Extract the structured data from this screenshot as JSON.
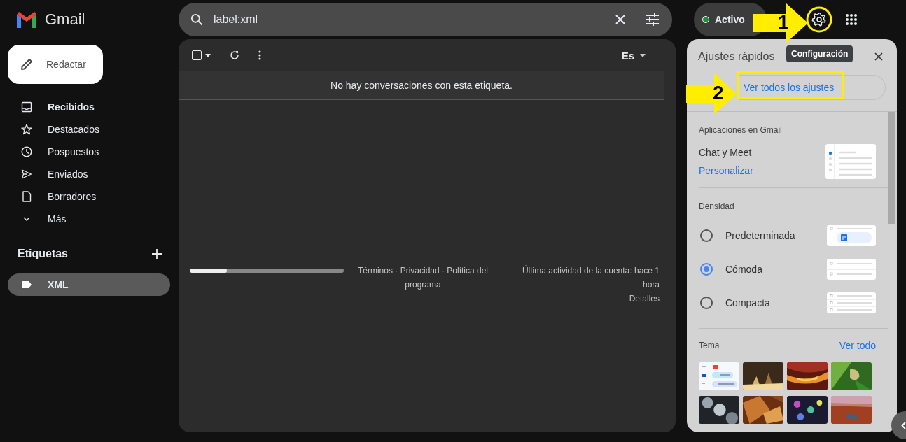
{
  "app": {
    "name": "Gmail"
  },
  "compose": {
    "label": "Redactar"
  },
  "nav": [
    {
      "label": "Recibidos",
      "selected": true
    },
    {
      "label": "Destacados",
      "selected": false
    },
    {
      "label": "Pospuestos",
      "selected": false
    },
    {
      "label": "Enviados",
      "selected": false
    },
    {
      "label": "Borradores",
      "selected": false
    },
    {
      "label": "Más",
      "selected": false
    }
  ],
  "labels": {
    "title": "Etiquetas",
    "items": [
      {
        "label": "XML",
        "selected": true
      }
    ]
  },
  "search": {
    "value": "label:xml"
  },
  "status": {
    "label": "Activo",
    "color": "#1e8e3e"
  },
  "toolbar": {
    "select_all": {
      "checked": false
    },
    "input_tool": "Es"
  },
  "message": "No hay conversaciones con esta etiqueta.",
  "footer": {
    "storage": {
      "level": 0.24
    },
    "links": "Términos · Privacidad · Política del programa",
    "activity": "Última actividad de la cuenta: hace 1 hora",
    "details": "Detalles"
  },
  "tooltip": "Configuración",
  "annotations": [
    "1",
    "2"
  ],
  "quick_settings": {
    "title": "Ajustes rápidos",
    "all_settings": "Ver todos los ajustes",
    "apps": {
      "title": "Aplicaciones en Gmail",
      "item": "Chat y Meet",
      "link": "Personalizar"
    },
    "density": {
      "title": "Densidad",
      "options": [
        {
          "label": "Predeterminada",
          "kind": "default",
          "selected": false
        },
        {
          "label": "Cómoda",
          "kind": "comfortable",
          "selected": true
        },
        {
          "label": "Compacta",
          "kind": "compact",
          "selected": false
        }
      ]
    },
    "theme": {
      "title": "Tema",
      "link": "Ver todo",
      "items": [
        {
          "kind": "default"
        },
        {
          "kind": "picture"
        },
        {
          "kind": "picture"
        },
        {
          "kind": "picture"
        },
        {
          "kind": "picture"
        },
        {
          "kind": "picture"
        },
        {
          "kind": "picture"
        },
        {
          "kind": "picture"
        }
      ]
    }
  }
}
